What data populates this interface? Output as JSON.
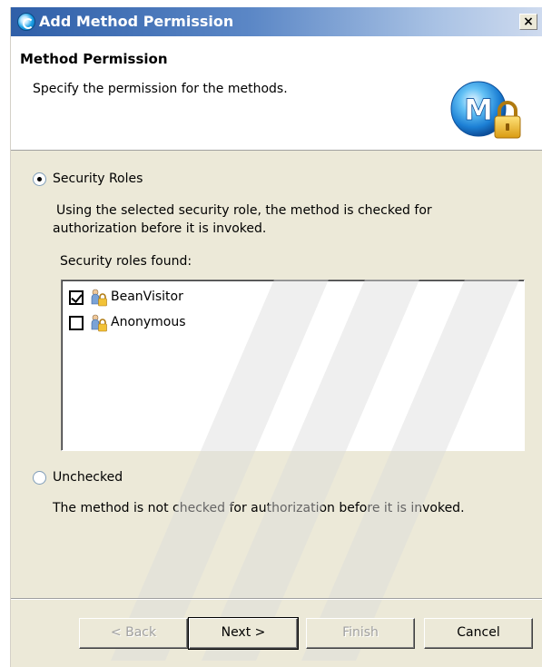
{
  "window": {
    "title": "Add Method Permission",
    "close_label": "×"
  },
  "header": {
    "title": "Method Permission",
    "description": "Specify the permission for the methods."
  },
  "options": {
    "security_roles": {
      "label": "Security Roles",
      "selected": true,
      "description": "Using the selected security role, the method is checked for authorization before it is invoked.",
      "list_label": "Security roles found:",
      "roles": [
        {
          "name": "BeanVisitor",
          "checked": true
        },
        {
          "name": "Anonymous",
          "checked": false
        }
      ]
    },
    "unchecked": {
      "label": "Unchecked",
      "selected": false,
      "description": "The method is not checked for authorization before it is invoked."
    }
  },
  "buttons": {
    "back": "< Back",
    "next": "Next >",
    "finish": "Finish",
    "cancel": "Cancel"
  },
  "colors": {
    "title_bar": "#2f5fa8",
    "dialog_bg": "#ece9d8",
    "header_bg": "#ffffff"
  },
  "icons": {
    "title": "wizard-app-icon",
    "logo": "method-lock-icon",
    "role": "security-role-icon"
  }
}
